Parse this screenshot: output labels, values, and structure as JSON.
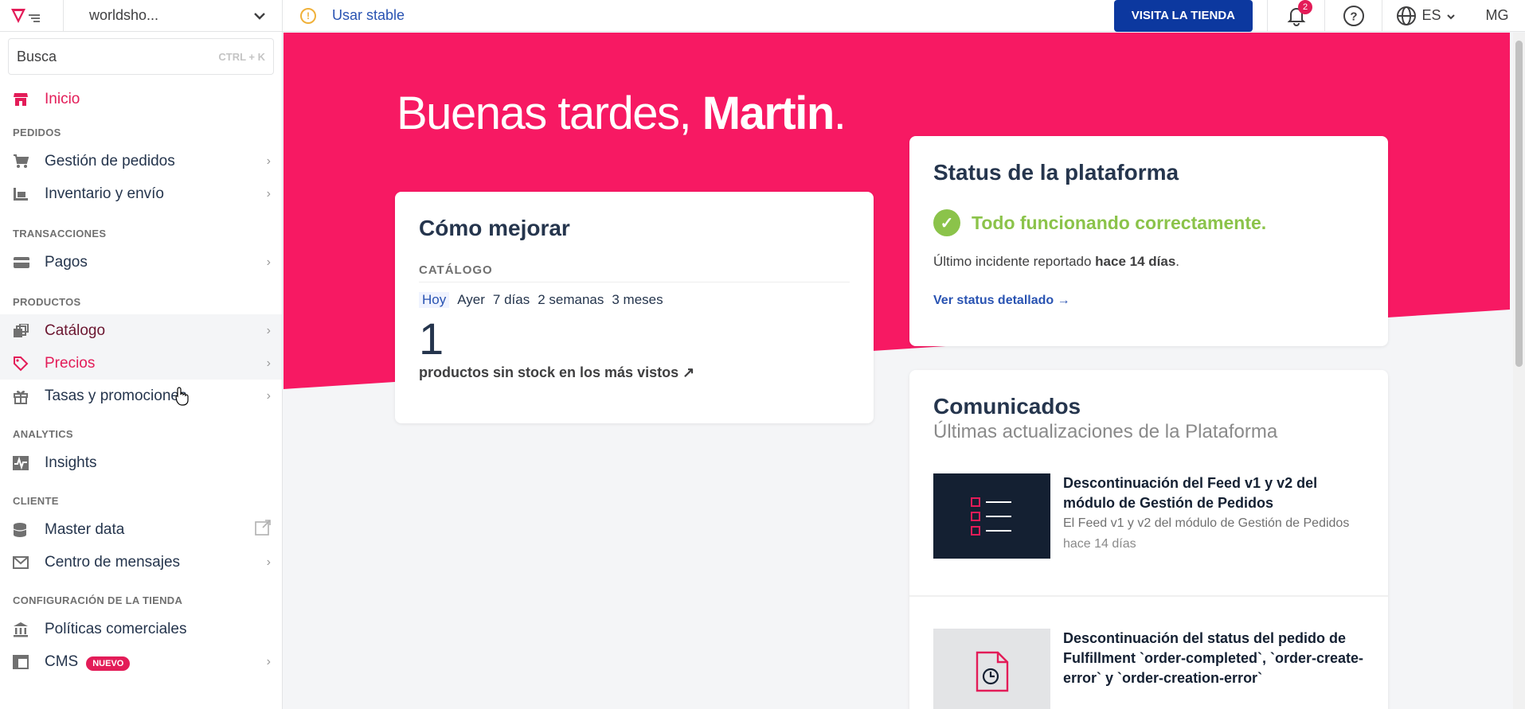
{
  "topbar": {
    "account": "worldsho...",
    "stable_label": "Usar stable",
    "visit_button": "VISITA LA TIENDA",
    "notifications_count": "2",
    "language": "ES",
    "user_initials": "MG",
    "accent_color": "#e31c58",
    "visit_color": "#0c389f"
  },
  "sidebar": {
    "search_placeholder": "Busca",
    "search_shortcut": "CTRL + K",
    "home": "Inicio",
    "sections": {
      "pedidos": "PEDIDOS",
      "transacciones": "TRANSACCIONES",
      "productos": "PRODUCTOS",
      "analytics": "ANALYTICS",
      "cliente": "CLIENTE",
      "config": "CONFIGURACIÓN DE LA TIENDA"
    },
    "items": {
      "gestion": "Gestión de pedidos",
      "inventario": "Inventario y envío",
      "pagos": "Pagos",
      "catalogo": "Catálogo",
      "precios": "Precios",
      "tasas": "Tasas y promociones",
      "insights": "Insights",
      "master": "Master data",
      "mensajes": "Centro de mensajes",
      "politicas": "Políticas comerciales",
      "cms": "CMS"
    },
    "new_badge": "NUEVO"
  },
  "hero": {
    "greeting": "Buenas tardes,",
    "name": "Martin",
    "dot": "."
  },
  "como_mejorar": {
    "title": "Cómo mejorar",
    "category": "CATÁLOGO",
    "periods": [
      "Hoy",
      "Ayer",
      "7 días",
      "2 semanas",
      "3 meses"
    ],
    "value": "1",
    "link": "productos sin stock en los más vistos ↗"
  },
  "status": {
    "title": "Status de la plataforma",
    "ok_text": "Todo funcionando correctamente.",
    "incident_prefix": "Último incidente reportado ",
    "incident_when": "hace 14 días",
    "incident_suffix": ".",
    "detail_link": "Ver status detallado →"
  },
  "comunicados": {
    "title": "Comunicados",
    "subtitle": "Últimas actualizaciones de la Plataforma",
    "news": [
      {
        "title": "Descontinuación del Feed v1 y v2 del módulo de Gestión de Pedidos",
        "desc": "El Feed v1 y v2 del módulo de Gestión de Pedidos",
        "ago": "hace 14 días"
      },
      {
        "title": "Descontinuación del status del pedido de Fulfillment `order-completed`, `order-create-error` y `order-creation-error`"
      }
    ]
  }
}
